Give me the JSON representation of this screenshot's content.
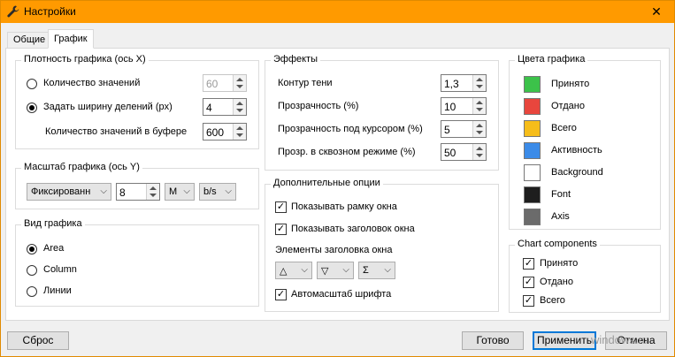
{
  "window": {
    "title": "Настройки"
  },
  "tabs": [
    {
      "label": "Общие"
    },
    {
      "label": "График"
    }
  ],
  "density": {
    "title": "Плотность графика (ось X)",
    "option_count_label": "Количество значений",
    "option_count_value": "60",
    "option_width_label": "Задать ширину делений (px)",
    "option_width_value": "4",
    "buffer_label": "Количество значений в буфере",
    "buffer_value": "600",
    "selected": "Задать ширину делений (px)"
  },
  "scale": {
    "title": "Масштаб графика (ось Y)",
    "mode": "Фиксированн",
    "value": "8",
    "unit": "M",
    "rate": "b/s"
  },
  "view": {
    "title": "Вид графика",
    "options": [
      "Area",
      "Column",
      "Линии"
    ],
    "selected": "Area"
  },
  "effects": {
    "title": "Эффекты",
    "shadow_label": "Контур тени",
    "shadow_value": "1,3",
    "transparency_label": "Прозрачность (%)",
    "transparency_value": "10",
    "hover_label": "Прозрачность под курсором (%)",
    "hover_value": "5",
    "passthrough_label": "Прозр. в сквозном режиме (%)",
    "passthrough_value": "50"
  },
  "extra": {
    "title": "Дополнительные опции",
    "show_frame": "Показывать рамку окна",
    "show_header": "Показывать заголовок окна",
    "header_elements_label": "Элементы заголовка окна",
    "sel1": "△",
    "sel2": "▽",
    "sel3": "Σ",
    "autoscale": "Автомасштаб шрифта"
  },
  "colors": {
    "title": "Цвета графика",
    "items": [
      {
        "label": "Принято",
        "color": "#3cc24a"
      },
      {
        "label": "Отдано",
        "color": "#e8463d"
      },
      {
        "label": "Всего",
        "color": "#f6bd1a"
      },
      {
        "label": "Активность",
        "color": "#3b8be8"
      },
      {
        "label": "Background",
        "color": "#ffffff"
      },
      {
        "label": "Font",
        "color": "#1e1e1e"
      },
      {
        "label": "Axis",
        "color": "#6b6b6b"
      }
    ]
  },
  "components": {
    "title": "Chart components",
    "items": [
      "Принято",
      "Отдано",
      "Всего"
    ]
  },
  "footer": {
    "reset": "Сброс",
    "ok": "Готово",
    "apply": "Применить",
    "cancel": "Отмена",
    "watermark": "windows.ru"
  }
}
